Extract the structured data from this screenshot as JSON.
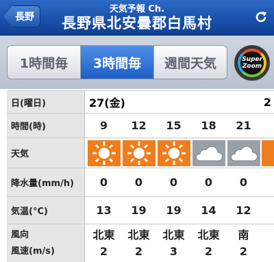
{
  "header": {
    "back_label": "長野",
    "subtitle": "天気予報 Ch.",
    "title": "長野県北安曇郡白馬村"
  },
  "tabs": [
    {
      "label": "1時間毎",
      "active": false
    },
    {
      "label": "3時間毎",
      "active": true
    },
    {
      "label": "週間天気",
      "active": false
    }
  ],
  "zoom": {
    "line1": "Super",
    "line2": "Zoom"
  },
  "table": {
    "labels": {
      "date": "日(曜日)",
      "time": "時間(時)",
      "weather": "天気",
      "rain": "降水量(mm/h)",
      "temp": "気温(°C)",
      "wind_dir": "風向",
      "wind_speed": "風速(m/s)"
    },
    "date": "27(金)",
    "date_next": "2",
    "times": [
      "9",
      "12",
      "15",
      "18",
      "21"
    ],
    "weather": [
      "sunny-icon",
      "sunny-icon",
      "sunny-icon",
      "cloudy-icon",
      "cloudy-icon"
    ],
    "rain": [
      "0",
      "0",
      "0",
      "0",
      "0"
    ],
    "temp": [
      "13",
      "19",
      "19",
      "14",
      "12"
    ],
    "wind_dir": [
      "北東",
      "北東",
      "北東",
      "北東",
      "南"
    ],
    "wind_speed": [
      "2",
      "2",
      "3",
      "2",
      "2"
    ]
  },
  "colors": {
    "sunny_bg": "#f07d1c",
    "cloudy_bg": "#9aa0a8",
    "nav": "#1b54ae",
    "active_tab": "#2f6fd4"
  }
}
